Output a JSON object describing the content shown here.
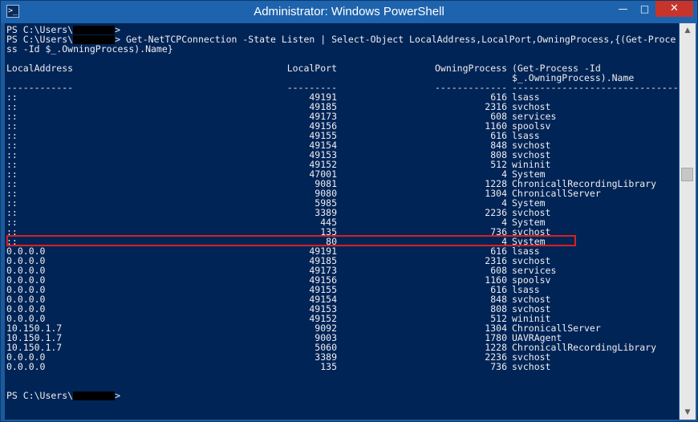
{
  "window": {
    "title": "Administrator: Windows PowerShell",
    "icon_glyph": ">_",
    "minimize": "—",
    "maximize": "□",
    "close": "✕"
  },
  "console": {
    "prompt_prefix": "PS C:\\Users\\",
    "prompt_suffix": ">",
    "command_line1": " Get-NetTCPConnection -State Listen | Select-Object LocalAddress,LocalPort,OwningProcess,{(Get-Proce",
    "command_line2": "ss -Id $_.OwningProcess).Name}",
    "headers": {
      "local_address": "LocalAddress",
      "local_port": "LocalPort",
      "owning_process": "OwningProcess",
      "name_line1": "(Get-Process -Id",
      "name_line2": "$_.OwningProcess).Name"
    },
    "separators": {
      "local_address": "------------",
      "local_port": "---------",
      "owning_process": "-------------",
      "name": "------------------------------"
    },
    "rows": [
      {
        "addr": "::",
        "port": "49191",
        "pid": "616",
        "name": "lsass"
      },
      {
        "addr": "::",
        "port": "49185",
        "pid": "2316",
        "name": "svchost"
      },
      {
        "addr": "::",
        "port": "49173",
        "pid": "608",
        "name": "services"
      },
      {
        "addr": "::",
        "port": "49156",
        "pid": "1160",
        "name": "spoolsv"
      },
      {
        "addr": "::",
        "port": "49155",
        "pid": "616",
        "name": "lsass"
      },
      {
        "addr": "::",
        "port": "49154",
        "pid": "848",
        "name": "svchost"
      },
      {
        "addr": "::",
        "port": "49153",
        "pid": "808",
        "name": "svchost"
      },
      {
        "addr": "::",
        "port": "49152",
        "pid": "512",
        "name": "wininit"
      },
      {
        "addr": "::",
        "port": "47001",
        "pid": "4",
        "name": "System"
      },
      {
        "addr": "::",
        "port": "9081",
        "pid": "1228",
        "name": "ChronicallRecordingLibrary"
      },
      {
        "addr": "::",
        "port": "9080",
        "pid": "1304",
        "name": "ChronicallServer"
      },
      {
        "addr": "::",
        "port": "5985",
        "pid": "4",
        "name": "System"
      },
      {
        "addr": "::",
        "port": "3389",
        "pid": "2236",
        "name": "svchost"
      },
      {
        "addr": "::",
        "port": "445",
        "pid": "4",
        "name": "System"
      },
      {
        "addr": "::",
        "port": "135",
        "pid": "736",
        "name": "svchost"
      },
      {
        "addr": "::",
        "port": "80",
        "pid": "4",
        "name": "System"
      },
      {
        "addr": "0.0.0.0",
        "port": "49191",
        "pid": "616",
        "name": "lsass"
      },
      {
        "addr": "0.0.0.0",
        "port": "49185",
        "pid": "2316",
        "name": "svchost"
      },
      {
        "addr": "0.0.0.0",
        "port": "49173",
        "pid": "608",
        "name": "services"
      },
      {
        "addr": "0.0.0.0",
        "port": "49156",
        "pid": "1160",
        "name": "spoolsv"
      },
      {
        "addr": "0.0.0.0",
        "port": "49155",
        "pid": "616",
        "name": "lsass"
      },
      {
        "addr": "0.0.0.0",
        "port": "49154",
        "pid": "848",
        "name": "svchost"
      },
      {
        "addr": "0.0.0.0",
        "port": "49153",
        "pid": "808",
        "name": "svchost"
      },
      {
        "addr": "0.0.0.0",
        "port": "49152",
        "pid": "512",
        "name": "wininit"
      },
      {
        "addr": "10.150.1.7",
        "port": "9092",
        "pid": "1304",
        "name": "ChronicallServer"
      },
      {
        "addr": "10.150.1.7",
        "port": "9003",
        "pid": "1780",
        "name": "UAVRAgent"
      },
      {
        "addr": "10.150.1.7",
        "port": "5060",
        "pid": "1228",
        "name": "ChronicallRecordingLibrary"
      },
      {
        "addr": "0.0.0.0",
        "port": "3389",
        "pid": "2236",
        "name": "svchost"
      },
      {
        "addr": "0.0.0.0",
        "port": "135",
        "pid": "736",
        "name": "svchost"
      }
    ]
  },
  "scrollbar": {
    "up_glyph": "▲",
    "down_glyph": "▼"
  }
}
